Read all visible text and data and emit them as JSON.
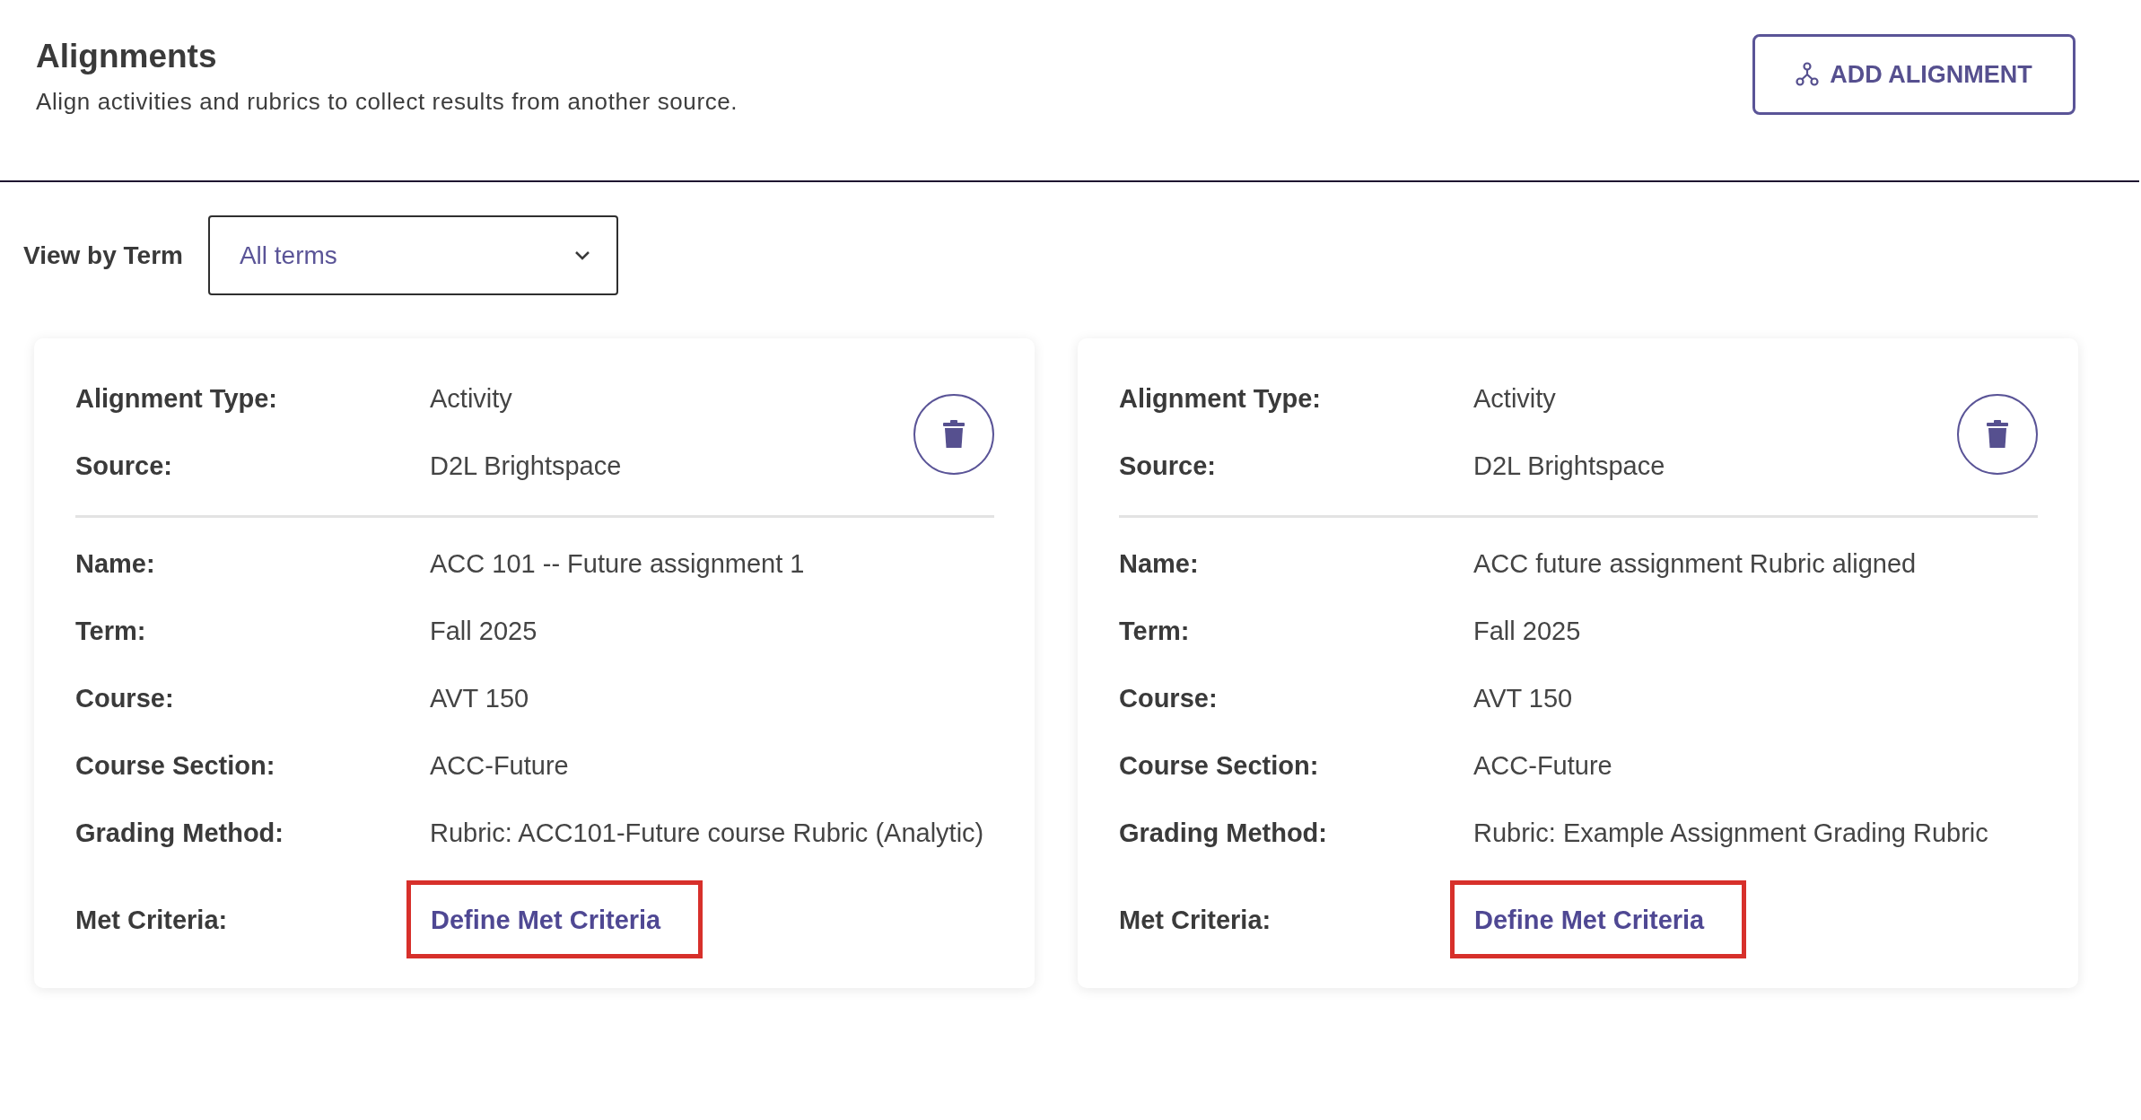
{
  "header": {
    "title": "Alignments",
    "subtitle": "Align activities and rubrics to collect results from another source.",
    "add_button": "ADD ALIGNMENT"
  },
  "filter": {
    "label": "View by Term",
    "value": "All terms"
  },
  "cards": [
    {
      "summary": [
        {
          "label": "Alignment Type:",
          "value": "Activity"
        },
        {
          "label": "Source:",
          "value": "D2L Brightspace"
        }
      ],
      "details": [
        {
          "label": "Name:",
          "value": "ACC 101 -- Future assignment 1"
        },
        {
          "label": "Term:",
          "value": "Fall 2025"
        },
        {
          "label": "Course:",
          "value": "AVT 150"
        },
        {
          "label": "Course Section:",
          "value": "ACC-Future"
        },
        {
          "label": "Grading Method:",
          "value": "Rubric: ACC101-Future course Rubric (Analytic)"
        }
      ],
      "met_criteria": {
        "label": "Met Criteria:",
        "link": "Define Met Criteria",
        "highlighted": true
      }
    },
    {
      "summary": [
        {
          "label": "Alignment Type:",
          "value": "Activity"
        },
        {
          "label": "Source:",
          "value": "D2L Brightspace"
        }
      ],
      "details": [
        {
          "label": "Name:",
          "value": "ACC future assignment Rubric aligned"
        },
        {
          "label": "Term:",
          "value": "Fall 2025"
        },
        {
          "label": "Course:",
          "value": "AVT 150"
        },
        {
          "label": "Course Section:",
          "value": "ACC-Future"
        },
        {
          "label": "Grading Method:",
          "value": "Rubric: Example Assignment Grading Rubric"
        }
      ],
      "met_criteria": {
        "label": "Met Criteria:",
        "link": "Define Met Criteria",
        "highlighted": true
      }
    }
  ]
}
